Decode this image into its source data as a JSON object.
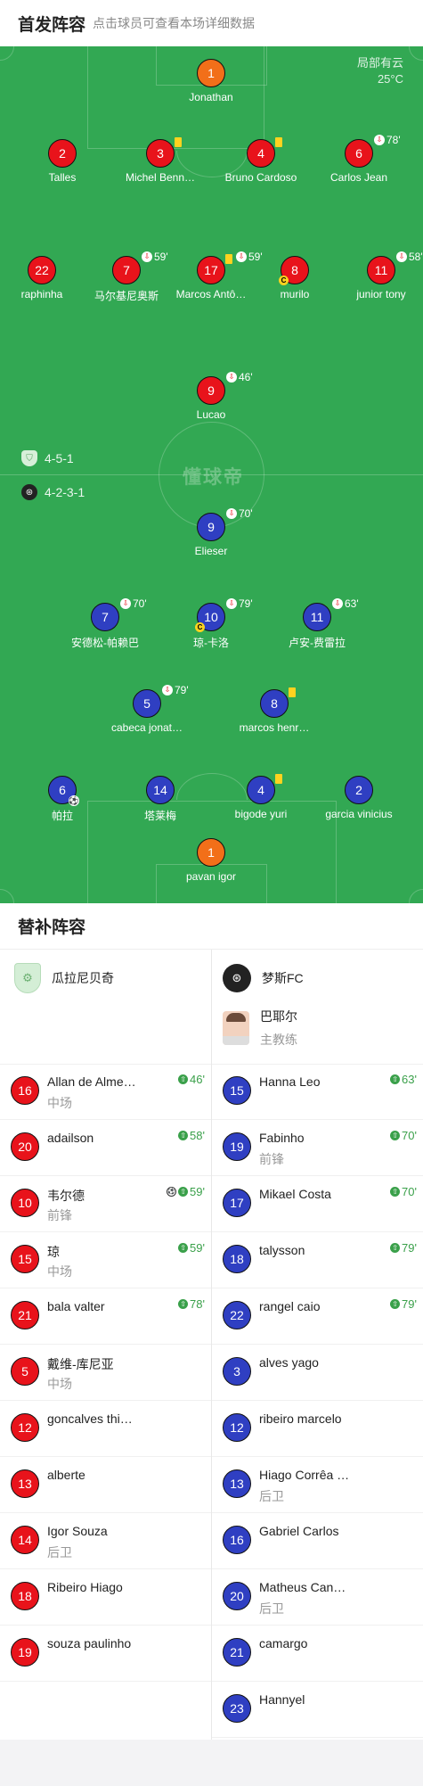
{
  "header": {
    "title": "首发阵容",
    "hint": "点击球员可查看本场详细数据"
  },
  "weather": {
    "condition": "局部有云",
    "temperature": "25°C"
  },
  "watermark": "懂球帝",
  "formations": {
    "home": "4-5-1",
    "away": "4-2-3-1"
  },
  "colors": {
    "pitch": "#32a853",
    "home_disc": "#e8131b",
    "away_disc": "#2f3fc2",
    "keeper_disc": "#f26f19",
    "sub_in": "#3aa04a",
    "yellow_card": "#ffd21f"
  },
  "home_starters": [
    {
      "number": "1",
      "name": "Jonathan",
      "role": "keeper"
    },
    {
      "number": "2",
      "name": "Talles"
    },
    {
      "number": "3",
      "name": "Michel Benn…",
      "yellow_card": true
    },
    {
      "number": "4",
      "name": "Bruno Cardoso",
      "yellow_card": true
    },
    {
      "number": "6",
      "name": "Carlos Jean",
      "sub_minute": "78'"
    },
    {
      "number": "22",
      "name": "raphinha"
    },
    {
      "number": "7",
      "name": "马尔基尼奥斯",
      "sub_minute": "59'"
    },
    {
      "number": "17",
      "name": "Marcos Antô…",
      "yellow_card": true,
      "sub_minute": "59'"
    },
    {
      "number": "8",
      "name": "murilo",
      "captain": "C"
    },
    {
      "number": "11",
      "name": "junior tony",
      "sub_minute": "58'"
    },
    {
      "number": "9",
      "name": "Lucao",
      "sub_minute": "46'"
    }
  ],
  "away_starters": [
    {
      "number": "9",
      "name": "Elieser",
      "sub_minute": "70'"
    },
    {
      "number": "7",
      "name": "安德松-帕赖巴",
      "sub_minute": "70'"
    },
    {
      "number": "10",
      "name": "琼-卡洛",
      "sub_minute": "79'",
      "captain": "C"
    },
    {
      "number": "11",
      "name": "卢安-费雷拉",
      "sub_minute": "63'"
    },
    {
      "number": "5",
      "name": "cabeca jonat…",
      "sub_minute": "79'"
    },
    {
      "number": "8",
      "name": "marcos henr…",
      "yellow_card": true
    },
    {
      "number": "6",
      "name": "帕拉",
      "goal": true
    },
    {
      "number": "14",
      "name": "塔莱梅"
    },
    {
      "number": "4",
      "name": "bigode yuri",
      "yellow_card": true
    },
    {
      "number": "2",
      "name": "garcia vinicius"
    },
    {
      "number": "1",
      "name": "pavan igor",
      "role": "keeper"
    }
  ],
  "subs": {
    "title": "替补阵容",
    "home_team": {
      "name": "瓜拉尼贝奇",
      "logo_icon": "shield-icon"
    },
    "away_team": {
      "name": "梦斯FC",
      "logo_icon": "club-crest-icon"
    },
    "away_coach": {
      "name": "巴耶尔",
      "role": "主教练"
    },
    "home": [
      {
        "number": "16",
        "name": "Allan de Alme…",
        "position": "中场",
        "minute": "46'"
      },
      {
        "number": "20",
        "name": "adailson",
        "position": "",
        "minute": "58'"
      },
      {
        "number": "10",
        "name": "韦尔德",
        "position": "前锋",
        "minute": "59'",
        "goal": true
      },
      {
        "number": "15",
        "name": "琼",
        "position": "中场",
        "minute": "59'"
      },
      {
        "number": "21",
        "name": "bala valter",
        "position": "",
        "minute": "78'"
      },
      {
        "number": "5",
        "name": "戴维-库尼亚",
        "position": "中场",
        "minute": ""
      },
      {
        "number": "12",
        "name": "goncalves thi…",
        "position": "",
        "minute": ""
      },
      {
        "number": "13",
        "name": "alberte",
        "position": "",
        "minute": ""
      },
      {
        "number": "14",
        "name": "Igor Souza",
        "position": "后卫",
        "minute": ""
      },
      {
        "number": "18",
        "name": "Ribeiro Hiago",
        "position": "",
        "minute": ""
      },
      {
        "number": "19",
        "name": "souza paulinho",
        "position": "",
        "minute": ""
      }
    ],
    "away": [
      {
        "number": "15",
        "name": "Hanna Leo",
        "position": "",
        "minute": "63'"
      },
      {
        "number": "19",
        "name": "Fabinho",
        "position": "前锋",
        "minute": "70'"
      },
      {
        "number": "17",
        "name": "Mikael Costa",
        "position": "",
        "minute": "70'"
      },
      {
        "number": "18",
        "name": "talysson",
        "position": "",
        "minute": "79'"
      },
      {
        "number": "22",
        "name": "rangel caio",
        "position": "",
        "minute": "79'"
      },
      {
        "number": "3",
        "name": "alves yago",
        "position": "",
        "minute": ""
      },
      {
        "number": "12",
        "name": "ribeiro marcelo",
        "position": "",
        "minute": ""
      },
      {
        "number": "13",
        "name": "Hiago Corrêa …",
        "position": "后卫",
        "minute": ""
      },
      {
        "number": "16",
        "name": "Gabriel Carlos",
        "position": "",
        "minute": ""
      },
      {
        "number": "20",
        "name": "Matheus Can…",
        "position": "后卫",
        "minute": ""
      },
      {
        "number": "21",
        "name": "camargo",
        "position": "",
        "minute": ""
      },
      {
        "number": "23",
        "name": "Hannyel",
        "position": "",
        "minute": ""
      }
    ]
  }
}
